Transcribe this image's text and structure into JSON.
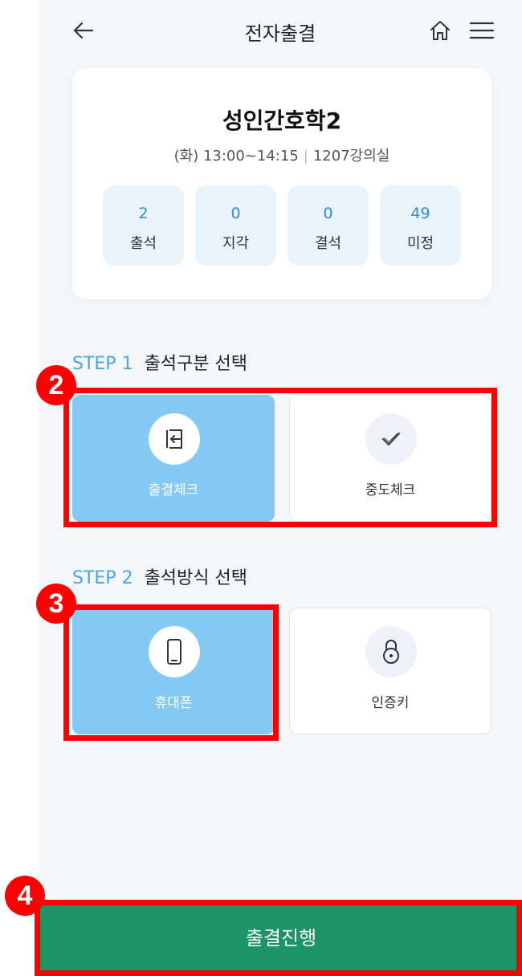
{
  "header": {
    "title": "전자출결",
    "back_icon": "arrow-left-icon",
    "home_icon": "home-icon",
    "menu_icon": "hamburger-menu-icon"
  },
  "course": {
    "title": "성인간호학2",
    "schedule": "(화) 13:00~14:15",
    "separator": "|",
    "room": "1207강의실",
    "stats": [
      {
        "value": "2",
        "label": "출석"
      },
      {
        "value": "0",
        "label": "지각"
      },
      {
        "value": "0",
        "label": "결석"
      },
      {
        "value": "49",
        "label": "미정"
      }
    ]
  },
  "step1": {
    "number": "STEP 1",
    "title": "출석구분 선택",
    "options": [
      {
        "label": "출결체크",
        "icon": "sign-in-icon",
        "selected": true
      },
      {
        "label": "중도체크",
        "icon": "checkmark-icon",
        "selected": false
      }
    ]
  },
  "step2": {
    "number": "STEP 2",
    "title": "출석방식 선택",
    "options": [
      {
        "label": "휴대폰",
        "icon": "smartphone-icon",
        "selected": true
      },
      {
        "label": "인증키",
        "icon": "padlock-icon",
        "selected": false
      }
    ]
  },
  "annotations": {
    "badge_2": "2",
    "badge_3": "3",
    "badge_4": "4"
  },
  "proceed_button": {
    "label": "출결진행"
  },
  "colors": {
    "accent_green": "#1c9466",
    "selected_blue": "#83c9f4",
    "step_blue": "#4aa6de",
    "annotation_red": "#ff0000"
  }
}
